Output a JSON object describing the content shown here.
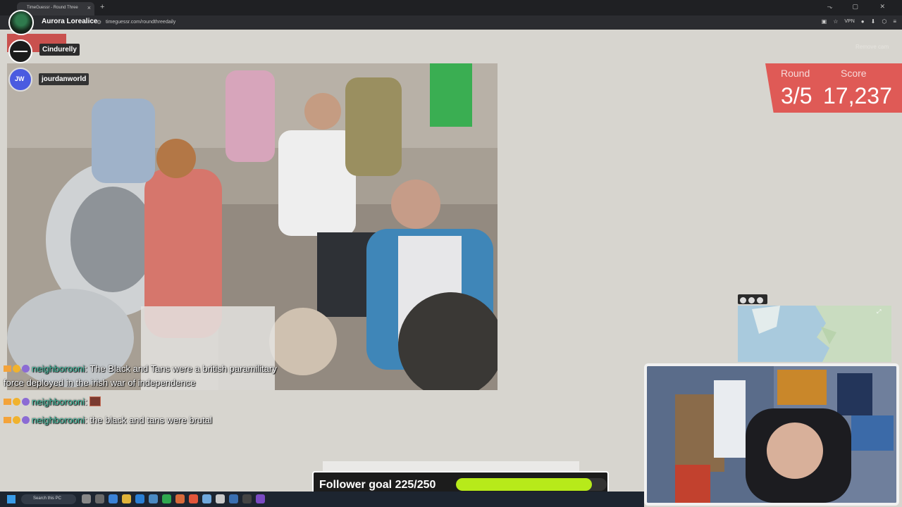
{
  "browser": {
    "tab_title": "TimeGuessr - Round Three",
    "tab_close": "×",
    "new_tab": "+",
    "url": "timeguessr.com/roundthreedaily",
    "vpn_label": "VPN",
    "window_controls": "– ▢ ✕"
  },
  "overlay": {
    "streamer_name": "Aurora Lorealice",
    "cam_names": [
      "Cindurelly",
      "jourdanworld"
    ],
    "remove_cam": "Remove cam"
  },
  "game": {
    "round_label": "Round",
    "round_value": "3/5",
    "score_label": "Score",
    "score_value": "17,237"
  },
  "chat": [
    {
      "user": "neighborooni",
      "text": "The Black and Tans were a british paramilitary force deployed in the irish war of independence"
    },
    {
      "user": "neighborooni",
      "text": ""
    },
    {
      "user": "neighborooni",
      "text": "the black and tans were brutal"
    }
  ],
  "follower_goal": {
    "label": "Follower goal 225/250",
    "current": 225,
    "target": 250
  },
  "taskbar": {
    "search_placeholder": "Search this PC"
  },
  "colors": {
    "score_panel": "#df5a56",
    "goal_fill": "#b7ea1a",
    "chat_username": "#47c0a4",
    "page_bg": "#d7d5cf"
  }
}
